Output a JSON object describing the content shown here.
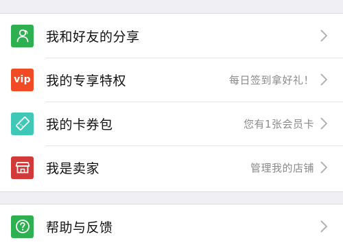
{
  "menu": {
    "group1": [
      {
        "label": "我和好友的分享",
        "subtext": "",
        "icon": "friends-share-icon",
        "icon_color": "#2db04f"
      },
      {
        "label": "我的专享特权",
        "subtext": "每日签到拿好礼！",
        "icon": "vip-icon",
        "icon_text": "vip",
        "icon_color": "#f04b24"
      },
      {
        "label": "我的卡券包",
        "subtext": "您有1张会员卡",
        "icon": "ticket-icon",
        "icon_color": "#3fc8b6"
      },
      {
        "label": "我是卖家",
        "subtext": "管理我的店铺",
        "icon": "store-icon",
        "icon_color": "#d23a3a"
      }
    ],
    "group2": [
      {
        "label": "帮助与反馈",
        "subtext": "",
        "icon": "help-icon",
        "icon_color": "#2db04f"
      }
    ]
  },
  "colors": {
    "background": "#efeff4",
    "chevron": "#b2b2b2",
    "subtext": "#8a8a8a"
  }
}
